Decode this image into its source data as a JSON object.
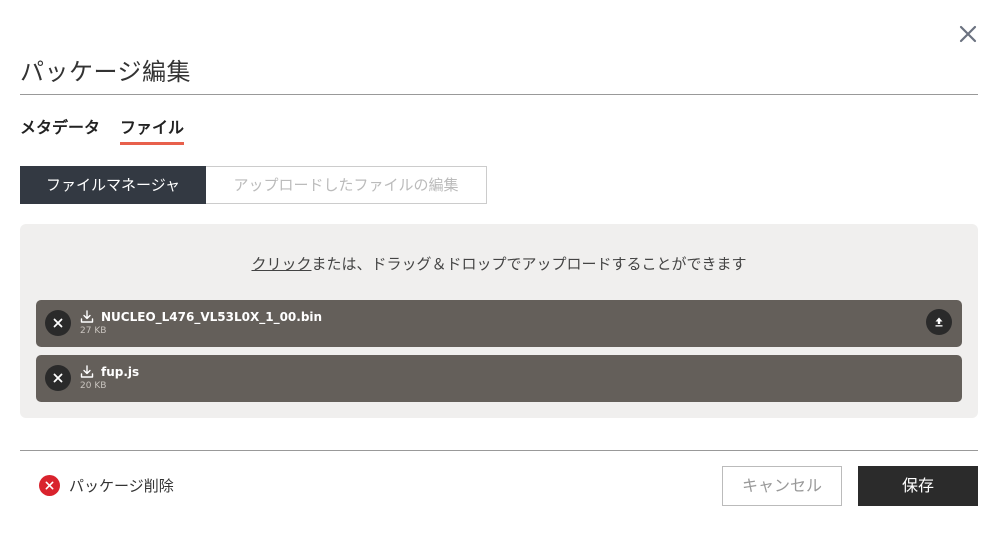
{
  "dialog": {
    "title": "パッケージ編集"
  },
  "tabs": [
    {
      "label": "メタデータ",
      "active": false
    },
    {
      "label": "ファイル",
      "active": true
    }
  ],
  "subtabs": [
    {
      "label": "ファイルマネージャ",
      "active": true
    },
    {
      "label": "アップロードしたファイルの編集",
      "active": false
    }
  ],
  "dropzone": {
    "hint_link": "クリック",
    "hint_rest": "または、ドラッグ＆ドロップでアップロードすることができます"
  },
  "files": [
    {
      "name": "NUCLEO_L476_VL53L0X_1_00.bin",
      "size": "27 KB",
      "has_upload_icon": true
    },
    {
      "name": "fup.js",
      "size": "20 KB",
      "has_upload_icon": false
    }
  ],
  "footer": {
    "delete_label": "パッケージ削除",
    "cancel_label": "キャンセル",
    "save_label": "保存"
  },
  "icons": {
    "close": "close-icon",
    "remove": "remove-icon",
    "download": "download-icon",
    "upload": "upload-icon",
    "delete": "delete-circle-icon"
  },
  "colors": {
    "accent": "#e8604c",
    "dark": "#333942",
    "file_bg": "#645f5a",
    "danger": "#d9232d"
  }
}
